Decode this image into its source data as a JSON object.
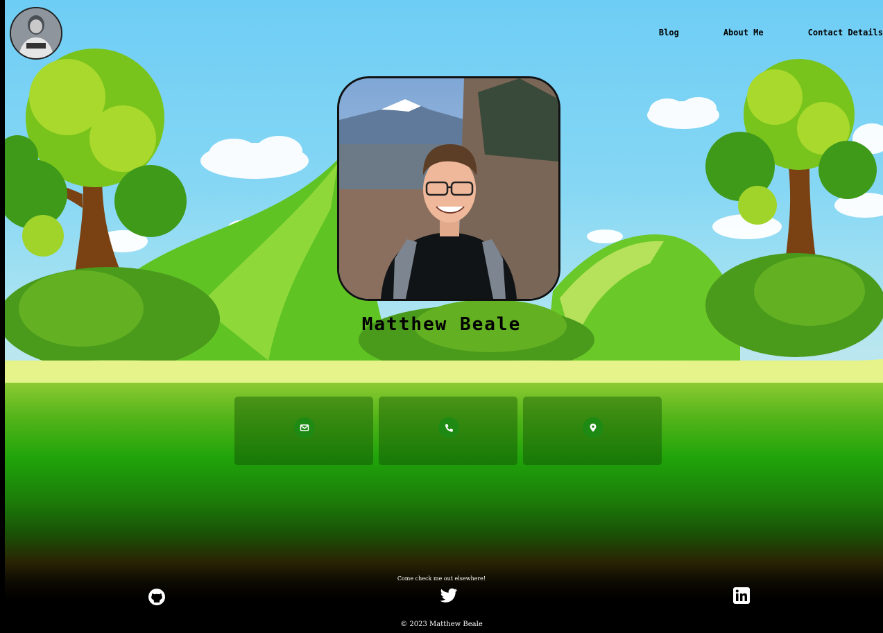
{
  "nav": {
    "items": [
      {
        "label": "Blog"
      },
      {
        "label": "About Me"
      },
      {
        "label": "Contact Details"
      }
    ]
  },
  "hero": {
    "name": "Matthew Beale"
  },
  "contact_cards": [
    {
      "icon": "envelope-icon"
    },
    {
      "icon": "phone-icon"
    },
    {
      "icon": "location-pin-icon"
    }
  ],
  "footer": {
    "tagline": "Come check me out elsewhere!",
    "social": [
      {
        "icon": "github-icon"
      },
      {
        "icon": "twitter-icon"
      },
      {
        "icon": "linkedin-icon"
      }
    ],
    "copyright": "© 2023 Matthew Beale"
  },
  "colors": {
    "sky": "#6ecdf5",
    "grass": "#20a40a",
    "icon_circle": "#1e8a14",
    "text": "#000000"
  }
}
